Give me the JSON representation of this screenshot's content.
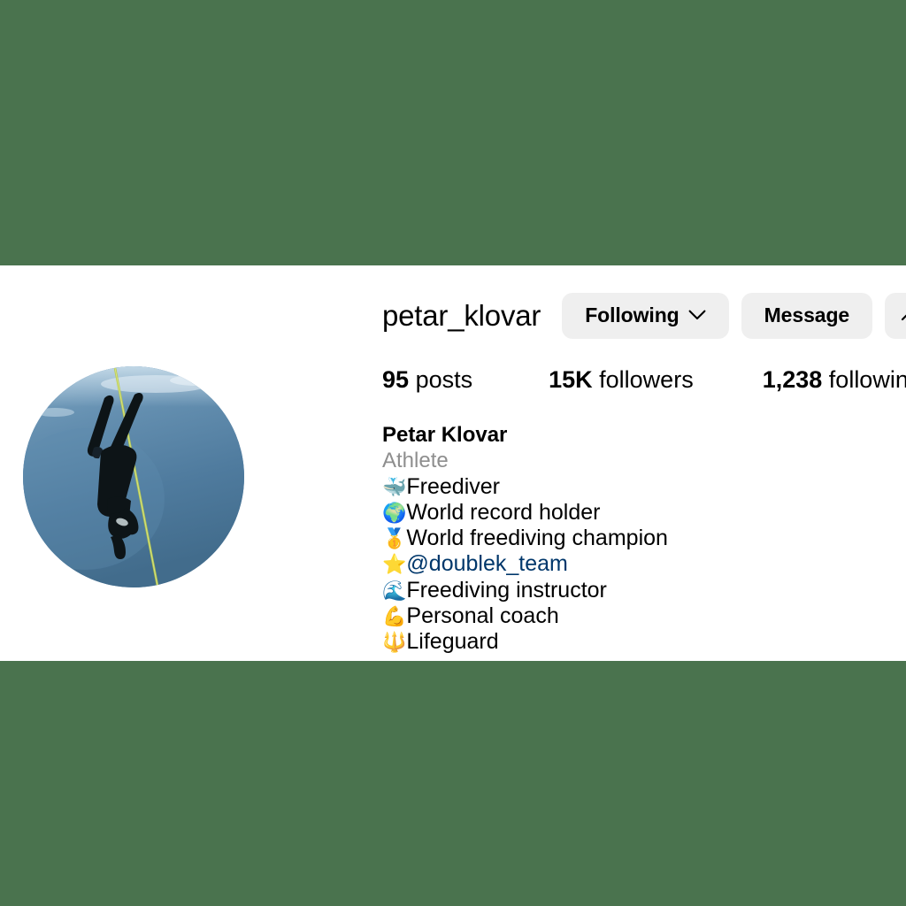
{
  "page": {
    "background_color": "#4a734e",
    "band_background": "#ffffff"
  },
  "profile": {
    "username": "petar_klovar",
    "avatar": {
      "alt": "Freediver descending underwater along a guide line",
      "has_story_ring": true,
      "ring_gradient": [
        "#c13584",
        "#e1306c",
        "#f58529",
        "#fcaf45"
      ]
    },
    "actions": {
      "following_label": "Following",
      "chevron_icon": "chevron-down-icon",
      "message_label": "Message",
      "more_label": ""
    },
    "stats": {
      "posts": {
        "count": "95",
        "label": "posts"
      },
      "followers": {
        "count": "15K",
        "label": "followers"
      },
      "following": {
        "count": "1,238",
        "label": "following"
      }
    },
    "bio": {
      "full_name": "Petar Klovar",
      "category": "Athlete",
      "lines": [
        {
          "emoji": "🐳",
          "text": "Freediver",
          "mention": false
        },
        {
          "emoji": "🌍",
          "text": "World record holder",
          "mention": false
        },
        {
          "emoji": "🥇",
          "text": "World freediving champion",
          "mention": false
        },
        {
          "emoji": "⭐",
          "text": "@doublek_team",
          "mention": true
        },
        {
          "emoji": "🌊",
          "text": "Freediving instructor",
          "mention": false
        },
        {
          "emoji": "💪",
          "text": "Personal coach",
          "mention": false
        },
        {
          "emoji": "🔱",
          "text": "Lifeguard",
          "mention": false
        }
      ],
      "mention_color": "#00376b"
    }
  }
}
